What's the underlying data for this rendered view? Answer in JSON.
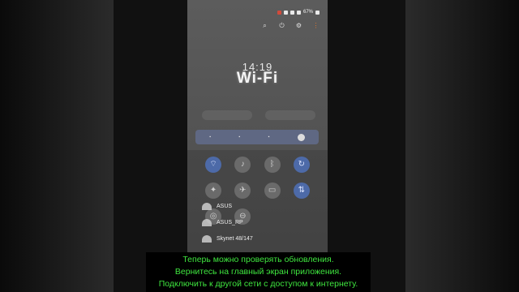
{
  "status_bar": {
    "battery": "67%"
  },
  "screen": {
    "clock": "14:19",
    "title": "Wi-Fi"
  },
  "wifi_networks": [
    {
      "name": "ASUS"
    },
    {
      "name": "ASUS_RP"
    },
    {
      "name": "Skynet 48/147"
    }
  ],
  "subtitles": [
    "Теперь можно проверять обновления.",
    "Вернитесь на главный экран приложения.",
    "Подключить к другой сети с доступом к интернету."
  ],
  "colors": {
    "subtitle_text": "#3fe63f",
    "qs_active": "#4d6aa8",
    "action_accent": "#e2762b"
  },
  "icons": {
    "top_actions": [
      "search-icon",
      "power-icon",
      "settings-icon",
      "more-icon"
    ],
    "quick_settings": [
      "wifi-icon",
      "sound-icon",
      "bluetooth-icon",
      "rotate-icon",
      "flashlight-icon",
      "airplane-icon",
      "battery-saver-icon",
      "data-icon",
      "hotspot-icon",
      "dnd-icon"
    ]
  }
}
